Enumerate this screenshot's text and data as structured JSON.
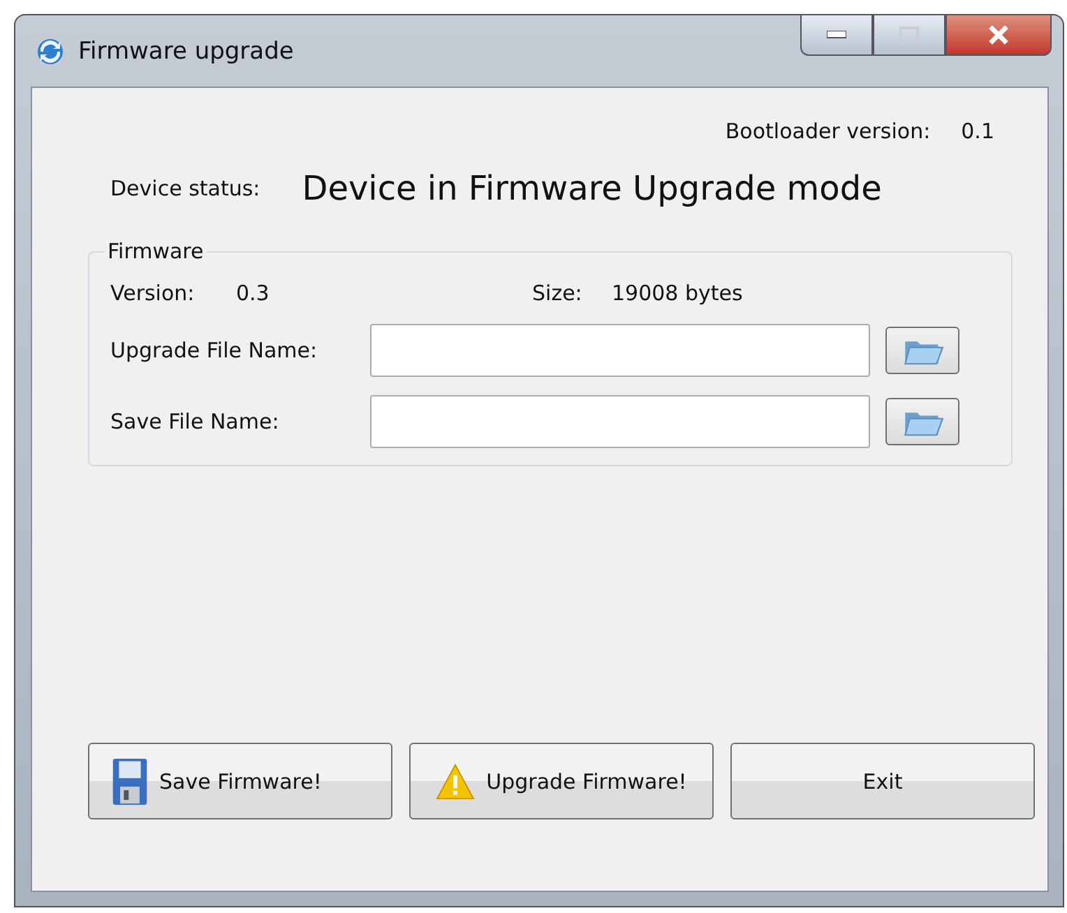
{
  "window": {
    "title": "Firmware upgrade"
  },
  "bootloader": {
    "label": "Bootloader version:",
    "value": "0.1"
  },
  "device_status": {
    "label": "Device status:",
    "value": "Device in Firmware Upgrade mode"
  },
  "firmware": {
    "title": "Firmware",
    "version_label": "Version:",
    "version": "0.3",
    "size_label": "Size:",
    "size": "19008 bytes",
    "fields": [
      {
        "label": "Upgrade File Name:"
      },
      {
        "label": "Save File Name:"
      }
    ]
  },
  "buttons": [
    {
      "label": "Save Firmware!",
      "kind": "save"
    },
    {
      "label": "Upgrade Firmware!",
      "kind": "warning"
    },
    {
      "label": "Exit",
      "kind": "plain"
    }
  ]
}
